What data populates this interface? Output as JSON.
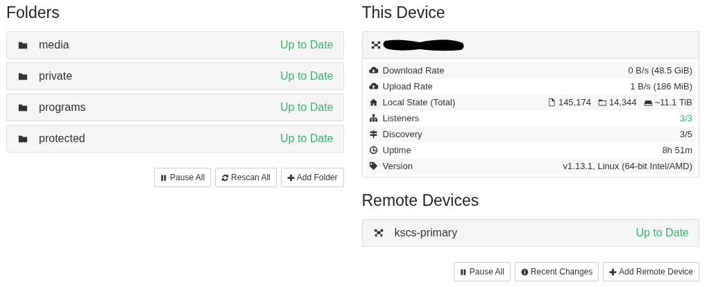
{
  "folders": {
    "title": "Folders",
    "items": [
      {
        "name": "media",
        "status": "Up to Date",
        "ok": true
      },
      {
        "name": "private",
        "status": "Up to Date",
        "ok": true
      },
      {
        "name": "programs",
        "status": "Up to Date",
        "ok": true
      },
      {
        "name": "protected",
        "status": "Up to Date",
        "ok": true
      }
    ],
    "buttons": [
      {
        "label": "Pause All",
        "kind": "pause"
      },
      {
        "label": "Rescan All",
        "kind": "refresh"
      },
      {
        "label": "Add Folder",
        "kind": "plus"
      }
    ]
  },
  "this_device": {
    "title": "This Device",
    "name_redacted": true,
    "stats": [
      {
        "kind": "download",
        "label": "Download Rate",
        "value": "0 B/s (48.5 GiB)",
        "ok": false
      },
      {
        "kind": "upload",
        "label": "Upload Rate",
        "value": "1 B/s (186 MiB)",
        "ok": false
      },
      {
        "kind": "home",
        "label": "Local State (Total)",
        "parts": [
          {
            "kind": "file",
            "text": "145,174"
          },
          {
            "kind": "folder",
            "text": "14,344"
          },
          {
            "kind": "drive",
            "text": "~11.1 TiB"
          }
        ],
        "ok": false
      },
      {
        "kind": "sitemap",
        "label": "Listeners",
        "value": "3/3",
        "ok": true
      },
      {
        "kind": "signpost",
        "label": "Discovery",
        "value": "3/5",
        "ok": false
      },
      {
        "kind": "clock",
        "label": "Uptime",
        "value": "8h 51m",
        "ok": false
      },
      {
        "kind": "tag",
        "label": "Version",
        "value": "v1.13.1, Linux (64-bit Intel/AMD)",
        "ok": false
      }
    ]
  },
  "remote_devices": {
    "title": "Remote Devices",
    "items": [
      {
        "name": "kscs-primary",
        "status": "Up to Date",
        "ok": true
      }
    ],
    "buttons": [
      {
        "label": "Pause All",
        "kind": "pause"
      },
      {
        "label": "Recent Changes",
        "kind": "info"
      },
      {
        "label": "Add Remote Device",
        "kind": "plus"
      }
    ]
  }
}
